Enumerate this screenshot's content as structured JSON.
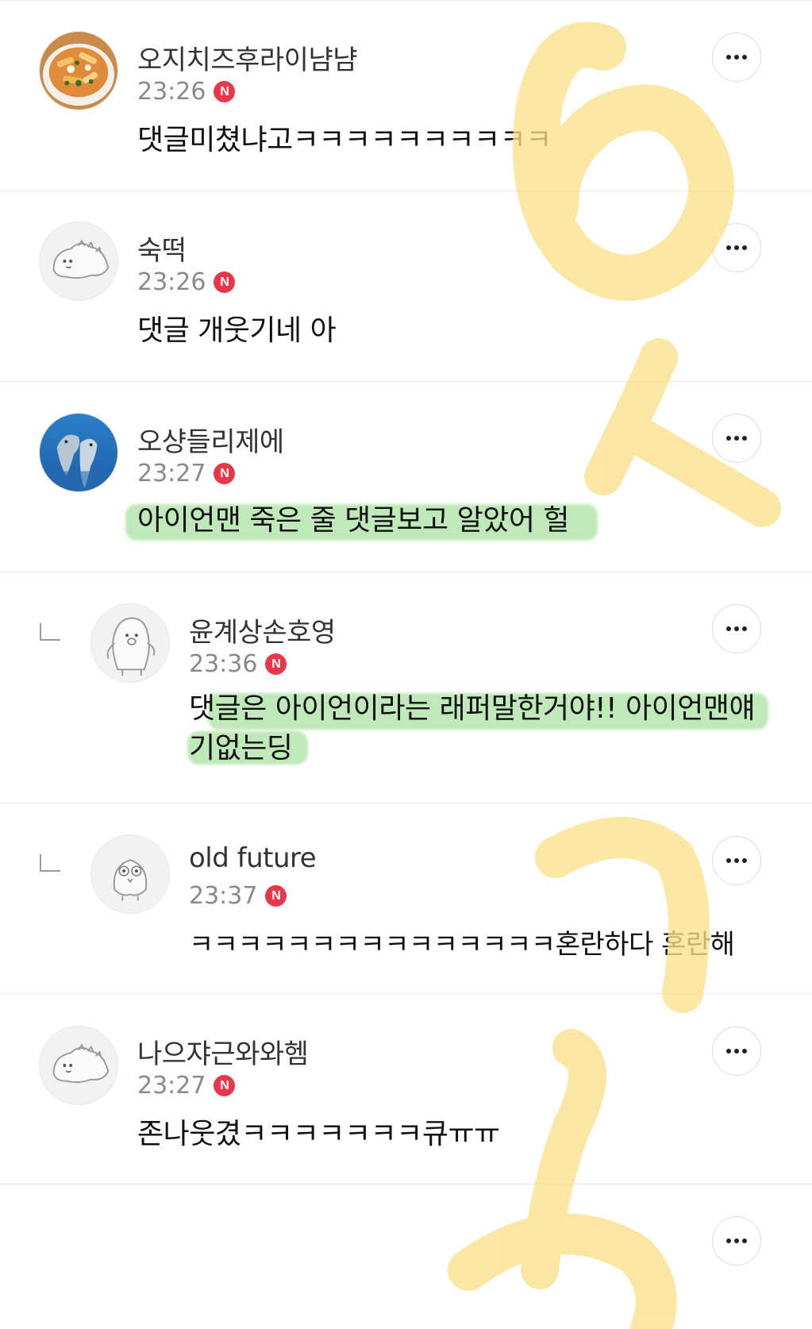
{
  "comments": [
    {
      "nickname": "오지치즈후라이냠냠",
      "time": "23:26",
      "badge": "N",
      "text": "댓글미쳤냐고ㅋㅋㅋㅋㅋㅋㅋㅋㅋㅋ",
      "avatar": "fries-photo-avatar",
      "reply": false
    },
    {
      "nickname": "숙떡",
      "time": "23:26",
      "badge": "N",
      "text": "댓글 개웃기네 아",
      "avatar": "default-dino-avatar",
      "reply": false
    },
    {
      "nickname": "오샹들리제에",
      "time": "23:27",
      "badge": "N",
      "text": "아이언맨 죽은 줄 댓글보고 알았어 헐",
      "avatar": "dolphin-photo-avatar",
      "reply": false
    },
    {
      "nickname": "윤계상손호영",
      "time": "23:36",
      "badge": "N",
      "text": "댓글은 아이언이라는 래퍼말한거야!! 아이언맨얘기없는딩",
      "text_line1": "댓글은 아이언이라는 래퍼말한거야!! 아이언맨얘",
      "text_line2": "기없는딩",
      "avatar": "default-penguin-avatar",
      "reply": true
    },
    {
      "nickname": "old future",
      "time": "23:37",
      "badge": "N",
      "text": "ㅋㅋㅋㅋㅋㅋㅋㅋㅋㅋㅋㅋㅋㅋㅋ혼란하다 혼란해",
      "avatar": "default-owl-avatar",
      "reply": true
    },
    {
      "nickname": "나으쟈근와와헴",
      "time": "23:27",
      "badge": "N",
      "text": "존나웃겼ㅋㅋㅋㅋㅋㅋㅋ큐ㅠㅠ",
      "avatar": "default-dino-avatar",
      "reply": false
    }
  ],
  "more_label": "more-options",
  "colors": {
    "highlight_green": "#8cd782",
    "marker_yellow": "#fbe08a",
    "badge_red": "#e8374a"
  }
}
